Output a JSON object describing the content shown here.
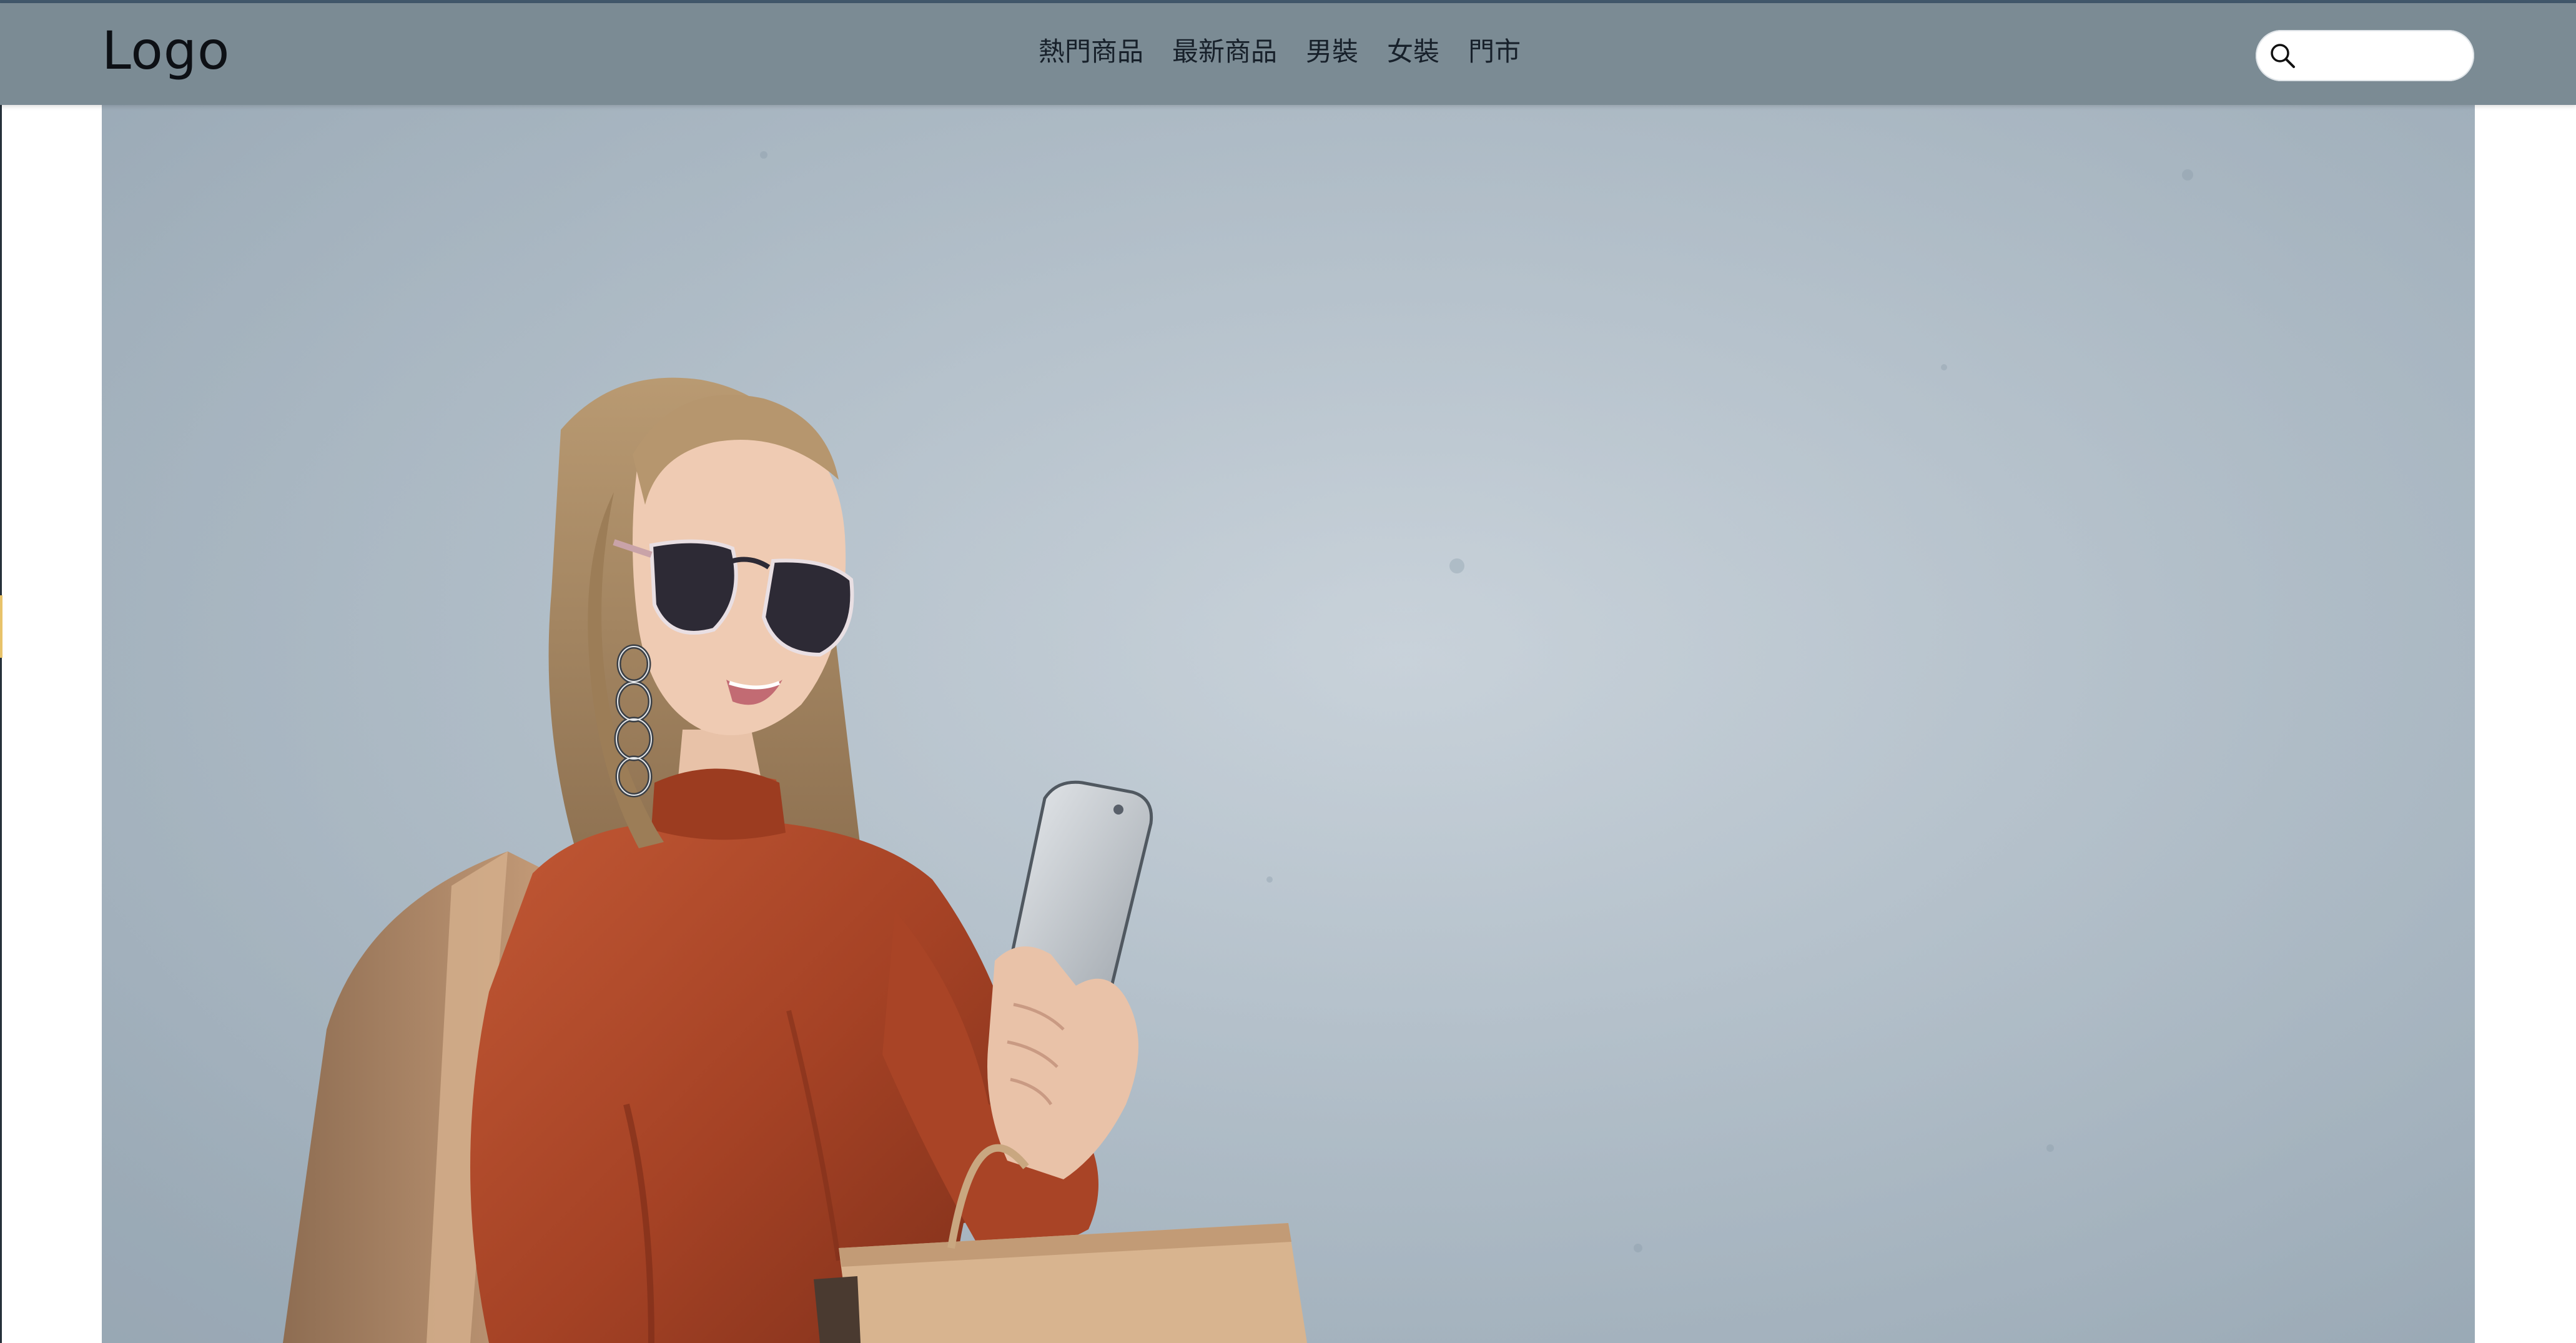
{
  "header": {
    "logo_text": "Logo",
    "nav": [
      {
        "label": "熱門商品"
      },
      {
        "label": "最新商品"
      },
      {
        "label": "男裝"
      },
      {
        "label": "女裝"
      },
      {
        "label": "門市"
      }
    ],
    "search": {
      "placeholder": "",
      "value": "",
      "icon": "search-icon"
    }
  },
  "colors": {
    "header_bg": "#7b8b94",
    "top_line": "#41576a",
    "hero_bg": "#b4c1cb",
    "dress": "#b04a2a",
    "coat": "#b08a6b"
  }
}
